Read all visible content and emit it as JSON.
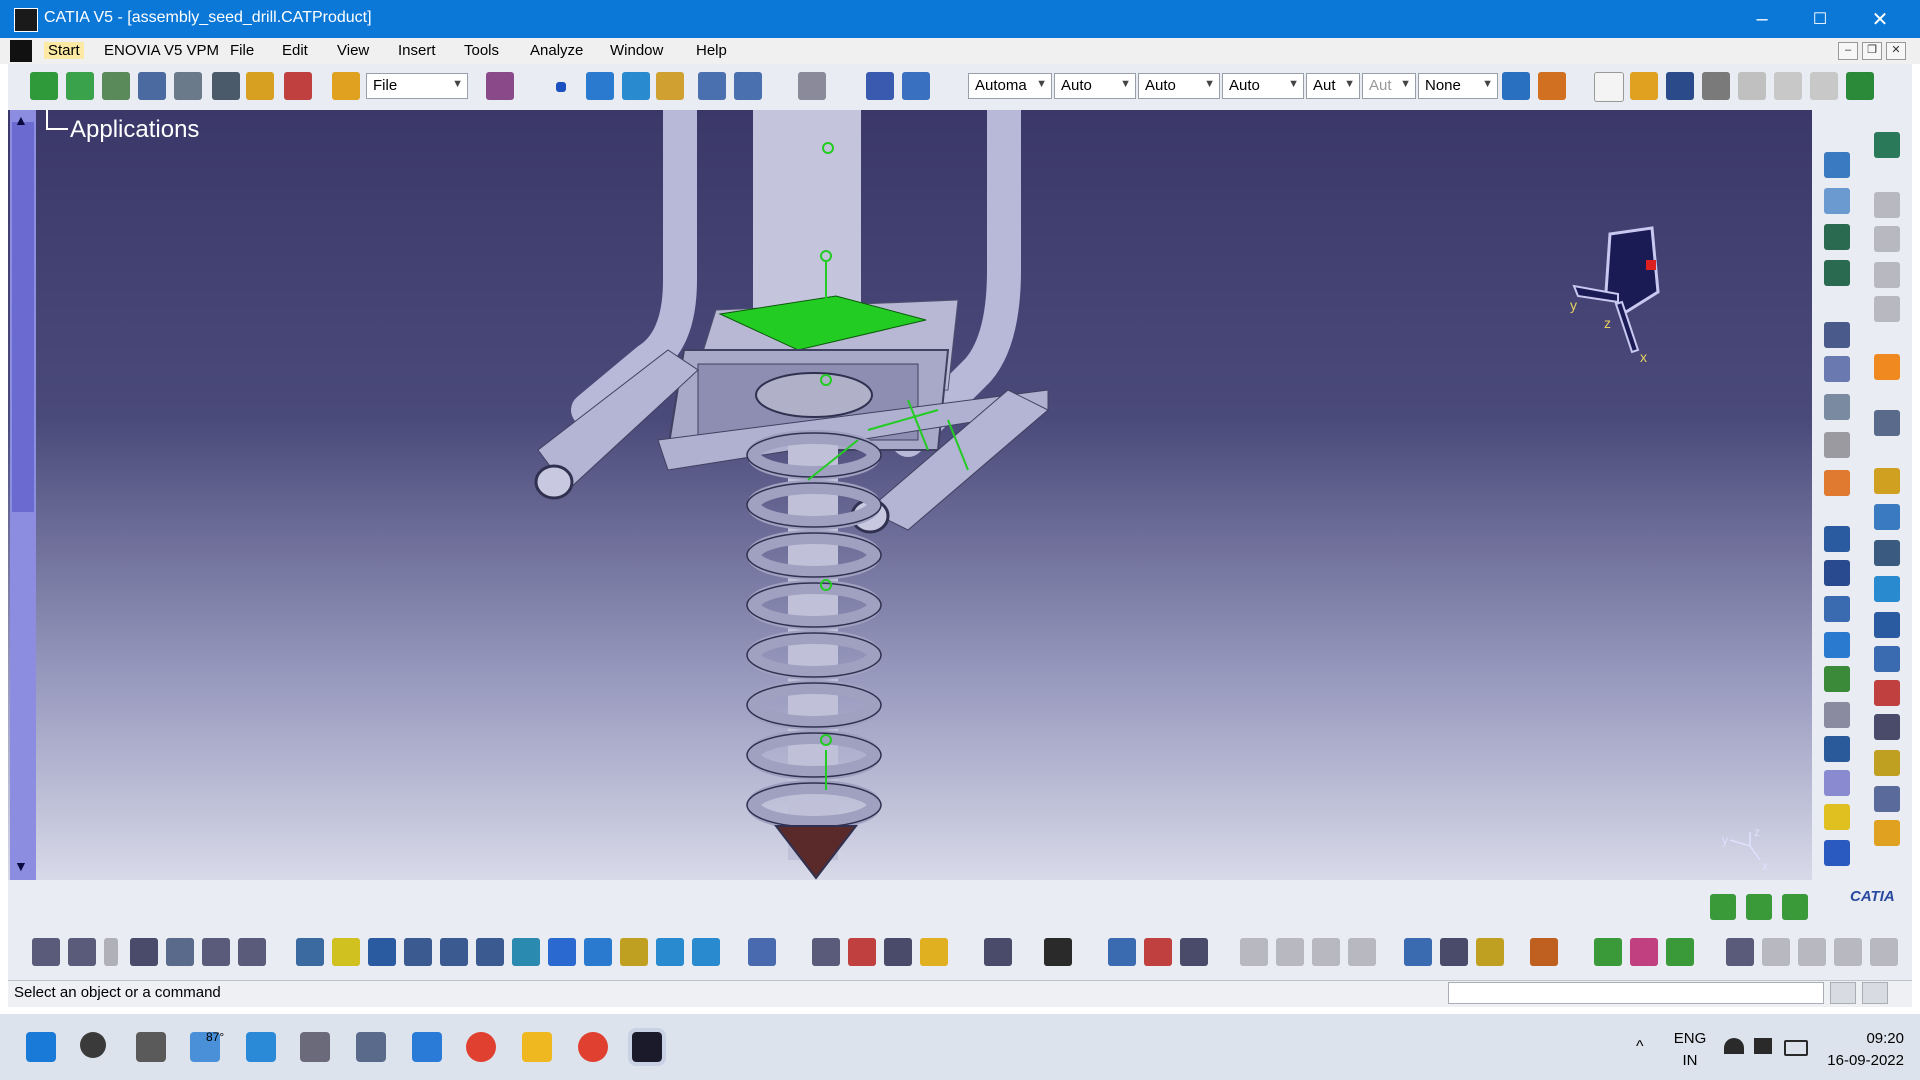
{
  "window": {
    "title": "CATIA V5 - [assembly_seed_drill.CATProduct]",
    "controls": [
      "–",
      "☐",
      "✕"
    ]
  },
  "menubar": {
    "items": [
      "Start",
      "ENOVIA V5 VPM",
      "File",
      "Edit",
      "View",
      "Insert",
      "Tools",
      "Analyze",
      "Window",
      "Help"
    ]
  },
  "toolbar": {
    "file_combo": "File",
    "combos": [
      "Automa",
      "Auto",
      "Auto",
      "Auto",
      "Aut",
      "Aut",
      "None"
    ]
  },
  "tree": {
    "label": "Applications"
  },
  "compass": {
    "axes": [
      "y",
      "z",
      "x"
    ]
  },
  "viewport_axes": {
    "labels": [
      "y",
      "z",
      "x"
    ]
  },
  "brand": {
    "logo_text": "CATIA"
  },
  "status": {
    "message": "Select an object or a command"
  },
  "taskbar": {
    "weather": "87°",
    "language": "ENG",
    "region": "IN",
    "time": "09:20",
    "date": "16-09-2022"
  },
  "colors": {
    "titlebar": "#0b78d7",
    "viewport_top": "#3b3869",
    "viewport_bottom": "#d8d9e8",
    "part": "#c8c8e0",
    "highlight_green": "#22cc22"
  }
}
